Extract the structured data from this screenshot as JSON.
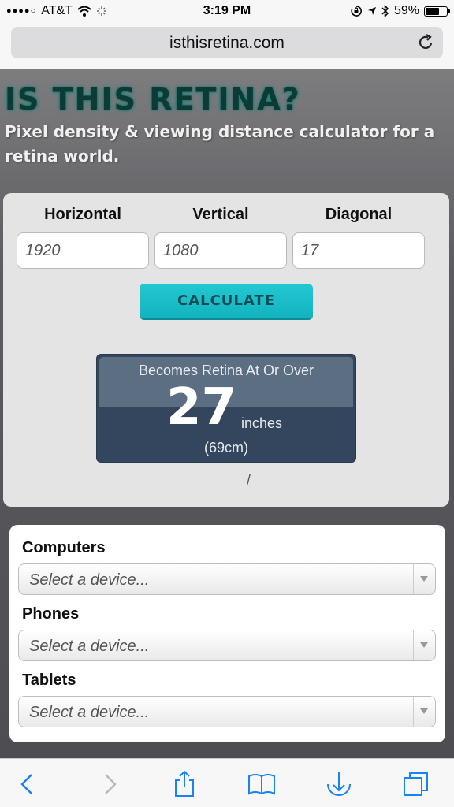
{
  "status_bar": {
    "carrier": "AT&T",
    "time": "3:19 PM",
    "battery_percent": "59%",
    "battery_level": 0.59,
    "icons": [
      "signal-dots-icon",
      "wifi-icon",
      "loading-icon",
      "orientation-lock-icon",
      "location-icon",
      "bluetooth-icon",
      "battery-icon"
    ]
  },
  "browser": {
    "url": "isthisretina.com",
    "reload_icon": "reload-icon"
  },
  "page": {
    "title": "IS THIS RETINA?",
    "subtitle": "Pixel density & viewing distance calculator for a retina world."
  },
  "calculator": {
    "fields": [
      {
        "label": "Horizontal",
        "value": "1920"
      },
      {
        "label": "Vertical",
        "value": "1080"
      },
      {
        "label": "Diagonal",
        "value": "17"
      }
    ],
    "button_label": "CALCULATE",
    "result": {
      "label": "Becomes Retina At Or Over",
      "value": "27",
      "unit": "inches",
      "metric": "(69cm)"
    },
    "separator": "/"
  },
  "devices": {
    "groups": [
      {
        "label": "Computers",
        "placeholder": "Select a device..."
      },
      {
        "label": "Phones",
        "placeholder": "Select a device..."
      },
      {
        "label": "Tablets",
        "placeholder": "Select a device..."
      }
    ]
  },
  "toolbar": {
    "icons": [
      "back-icon",
      "forward-icon",
      "share-icon",
      "bookmarks-icon",
      "download-icon",
      "tabs-icon"
    ]
  },
  "colors": {
    "accent": "#17bcc7",
    "result_bg": "#33465e",
    "title": "#0d3a35"
  }
}
